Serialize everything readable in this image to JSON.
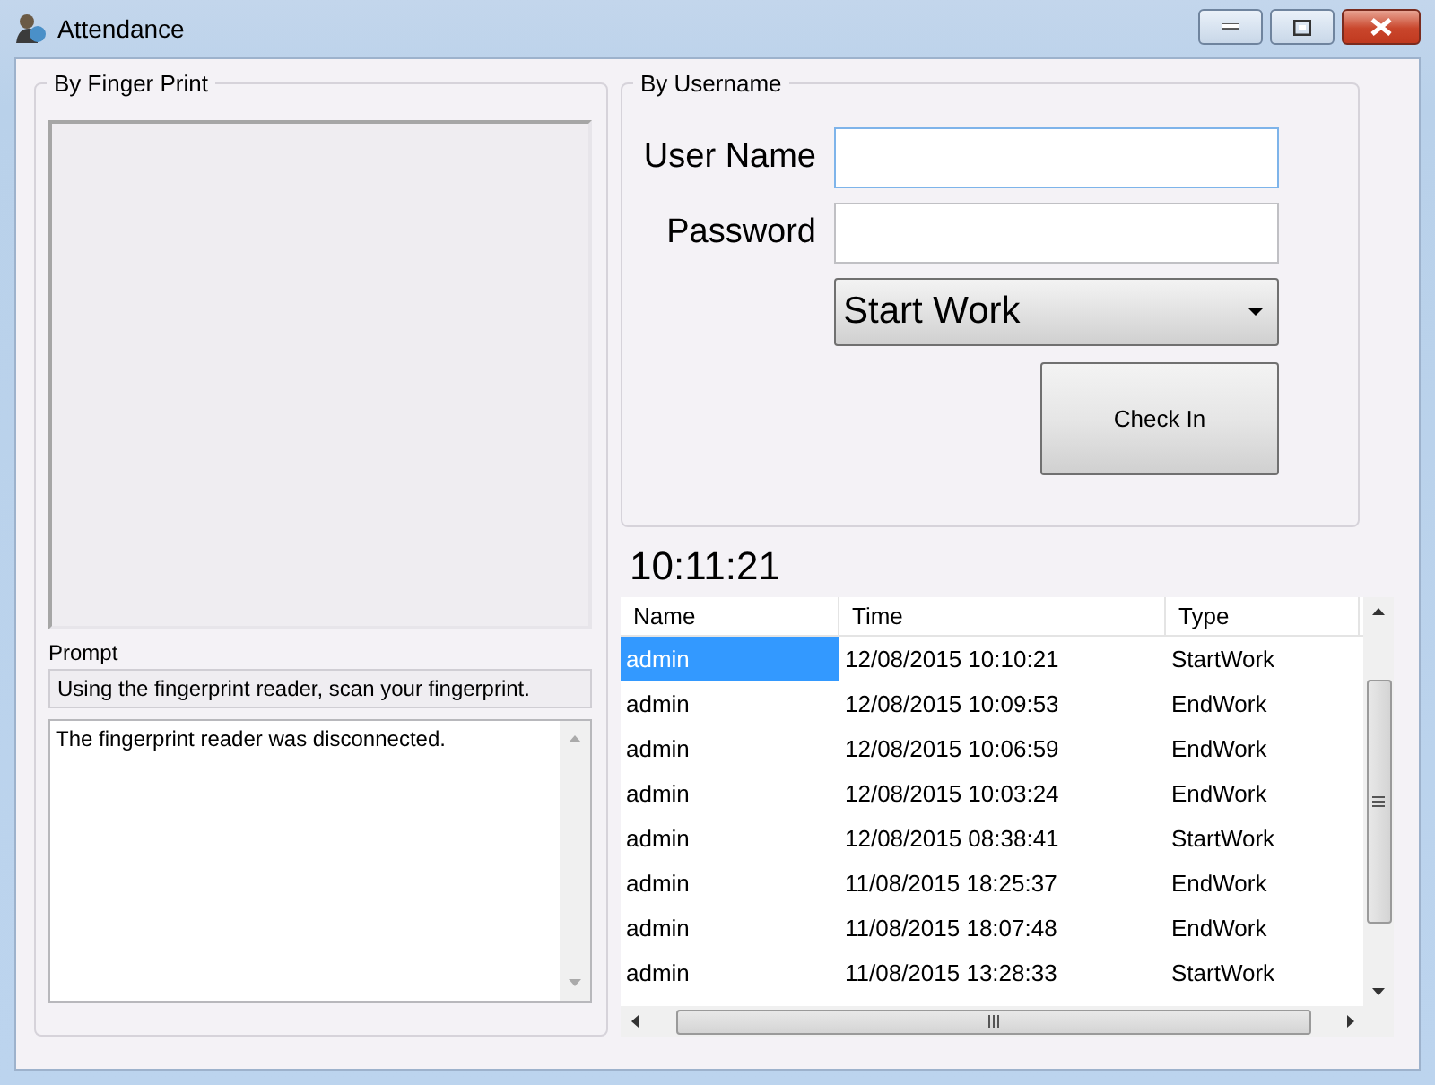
{
  "window": {
    "title": "Attendance"
  },
  "fingerprint_group": {
    "title": "By Finger Print",
    "prompt_label": "Prompt",
    "prompt": "Using the fingerprint reader, scan your fingerprint.",
    "messages": [
      "The fingerprint reader was disconnected."
    ]
  },
  "username_group": {
    "title": "By Username",
    "fields": [
      {
        "label": "User Name",
        "focused": true
      },
      {
        "label": "Password",
        "focused": false
      }
    ],
    "action_dropdown": {
      "value": "Start Work"
    },
    "check_in_button": "Check In"
  },
  "clock": "10:11:21",
  "table": {
    "columns": [
      "Name",
      "Time",
      "Type"
    ],
    "rows": [
      {
        "cells": [
          "admin",
          "12/08/2015 10:10:21",
          "StartWork"
        ],
        "selected": true
      },
      {
        "cells": [
          "admin",
          "12/08/2015 10:09:53",
          "EndWork"
        ],
        "selected": false
      },
      {
        "cells": [
          "admin",
          "12/08/2015 10:06:59",
          "EndWork"
        ],
        "selected": false
      },
      {
        "cells": [
          "admin",
          "12/08/2015 10:03:24",
          "EndWork"
        ],
        "selected": false
      },
      {
        "cells": [
          "admin",
          "12/08/2015 08:38:41",
          "StartWork"
        ],
        "selected": false
      },
      {
        "cells": [
          "admin",
          "11/08/2015 18:25:37",
          "EndWork"
        ],
        "selected": false
      },
      {
        "cells": [
          "admin",
          "11/08/2015 18:07:48",
          "EndWork"
        ],
        "selected": false
      },
      {
        "cells": [
          "admin",
          "11/08/2015 13:28:33",
          "StartWork"
        ],
        "selected": false
      }
    ]
  }
}
